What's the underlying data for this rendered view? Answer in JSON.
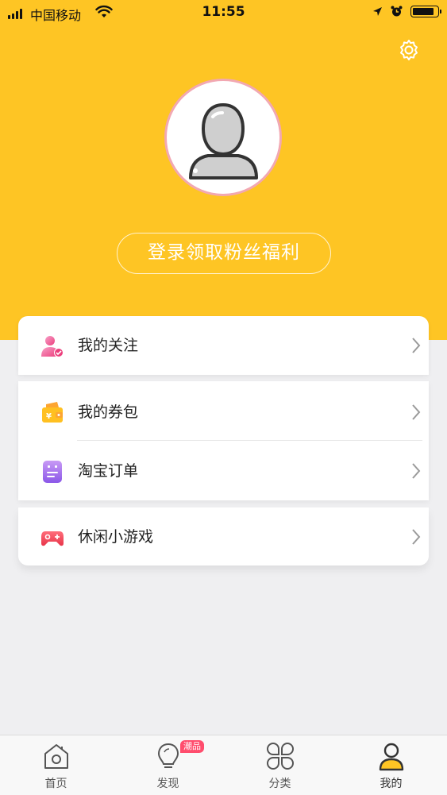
{
  "status_bar": {
    "carrier": "中国移动",
    "time": "11:55",
    "battery_level": 0.9,
    "icons": [
      "signal-icon",
      "wifi-icon",
      "location-icon",
      "alarm-icon",
      "battery-icon"
    ]
  },
  "header": {
    "settings_icon": "gear-icon",
    "avatar_icon": "default-avatar-icon",
    "login_label": "登录领取粉丝福利"
  },
  "menu": {
    "follow": {
      "label": "我的关注",
      "icon": "follow-user-icon"
    },
    "coupon": {
      "label": "我的券包",
      "icon": "wallet-icon"
    },
    "order": {
      "label": "淘宝订单",
      "icon": "order-note-icon"
    },
    "games": {
      "label": "休闲小游戏",
      "icon": "gamepad-icon"
    }
  },
  "tabs": {
    "home": {
      "label": "首页",
      "icon": "home-icon"
    },
    "discover": {
      "label": "发现",
      "icon": "lightbulb-icon",
      "badge": "潮品"
    },
    "category": {
      "label": "分类",
      "icon": "category-grid-icon"
    },
    "mine": {
      "label": "我的",
      "icon": "user-icon",
      "active": true
    }
  },
  "colors": {
    "accent": "#fec524",
    "background": "#efeff1",
    "badge": "#ff4d6d"
  }
}
